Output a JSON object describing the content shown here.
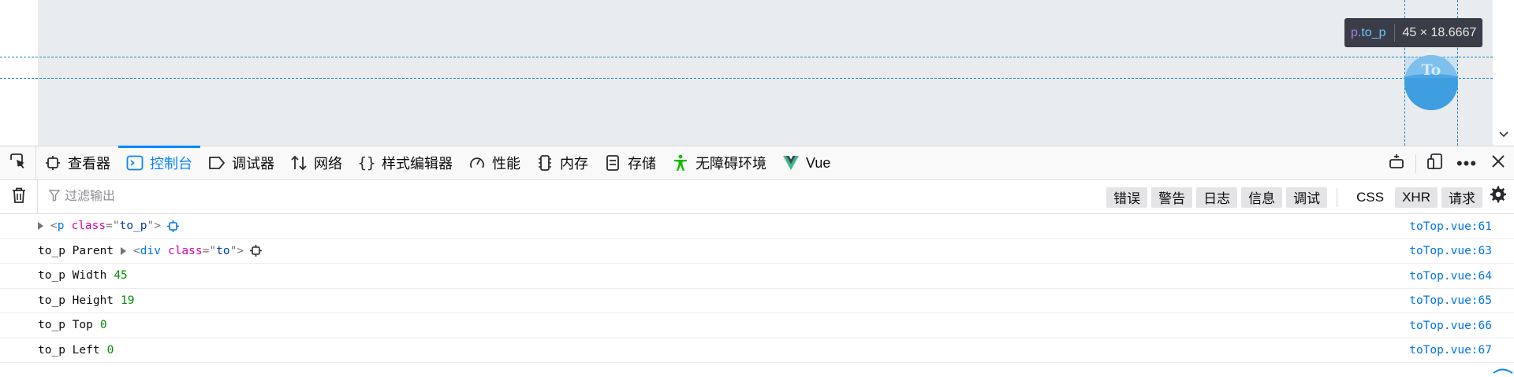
{
  "page": {
    "totop_text": "To",
    "tooltip": {
      "selector_tag": "p",
      "selector_class": ".to_p",
      "dimensions": "45 × 18.6667"
    }
  },
  "devtools": {
    "tabs": [
      {
        "label": "查看器",
        "icon": "inspector-icon"
      },
      {
        "label": "控制台",
        "icon": "console-icon",
        "active": true
      },
      {
        "label": "调试器",
        "icon": "debugger-icon"
      },
      {
        "label": "网络",
        "icon": "network-icon"
      },
      {
        "label": "样式编辑器",
        "icon": "style-editor-icon"
      },
      {
        "label": "性能",
        "icon": "performance-icon"
      },
      {
        "label": "内存",
        "icon": "memory-icon"
      },
      {
        "label": "存储",
        "icon": "storage-icon"
      },
      {
        "label": "无障碍环境",
        "icon": "accessibility-icon"
      },
      {
        "label": "Vue",
        "icon": "vue-icon"
      }
    ],
    "accent_color": "#0a84ff",
    "filter": {
      "placeholder": "过滤输出",
      "level_buttons": [
        "错误",
        "警告",
        "日志",
        "信息",
        "调试"
      ],
      "type_buttons": [
        "CSS",
        "XHR",
        "请求"
      ]
    }
  },
  "console": {
    "rows": [
      {
        "location": "toTop.vue:61"
      },
      {
        "label": "to_p Parent",
        "location": "toTop.vue:63"
      },
      {
        "label": "to_p Width",
        "value": "45",
        "location": "toTop.vue:64"
      },
      {
        "label": "to_p Height",
        "value": "19",
        "location": "toTop.vue:65"
      },
      {
        "label": "to_p Top",
        "value": "0",
        "location": "toTop.vue:66"
      },
      {
        "label": "to_p Left",
        "value": "0",
        "location": "toTop.vue:67"
      }
    ],
    "element_p": {
      "tag": "p",
      "attr": "class",
      "value": "to_p"
    },
    "element_div": {
      "tag": "div",
      "attr": "class",
      "value": "to"
    }
  }
}
